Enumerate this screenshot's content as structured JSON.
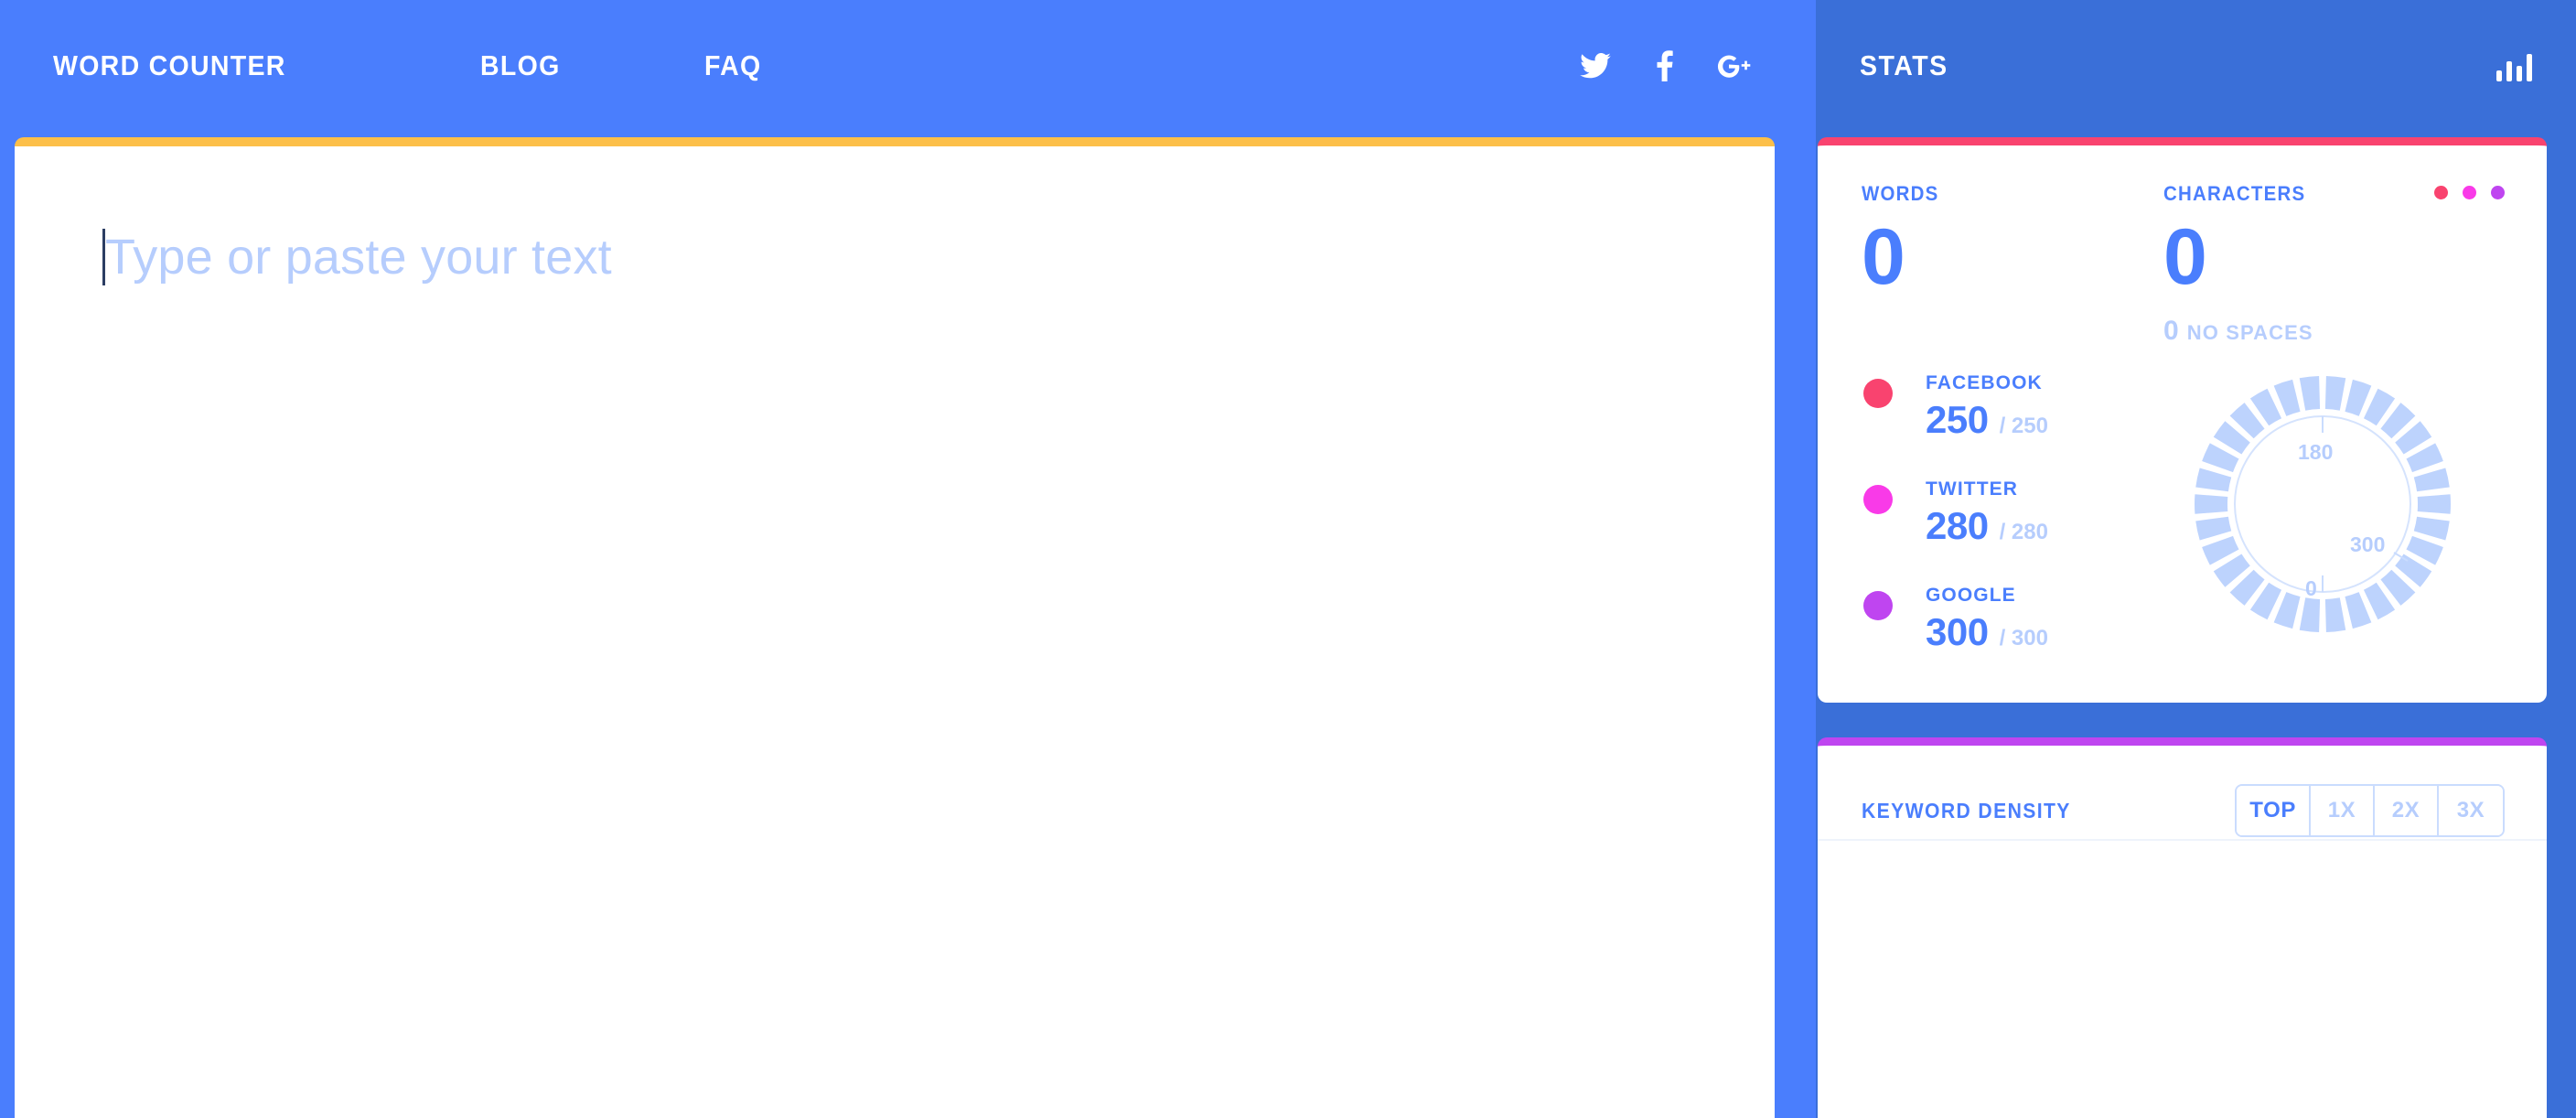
{
  "brand": {
    "accent_blue": "#4a7efd",
    "panel_blue": "#3a6fd8",
    "yellow": "#fcbf49",
    "pink": "#f9436f",
    "magenta": "#f93ae8",
    "purple": "#bf45f0"
  },
  "nav": {
    "items": [
      {
        "label": "WORD COUNTER",
        "name": "nav-word-counter"
      },
      {
        "label": "BLOG",
        "name": "nav-blog"
      },
      {
        "label": "FAQ",
        "name": "nav-faq"
      }
    ],
    "social": [
      {
        "icon": "twitter-icon",
        "label": "Twitter"
      },
      {
        "icon": "facebook-icon",
        "label": "Facebook"
      },
      {
        "icon": "google-plus-icon",
        "label": "Google Plus"
      }
    ]
  },
  "editor": {
    "placeholder": "Type or paste your text",
    "value": ""
  },
  "stats": {
    "title": "STATS",
    "icon": "bar-chart-icon",
    "words": {
      "label": "WORDS",
      "value": "0"
    },
    "characters": {
      "label": "CHARACTERS",
      "value": "0",
      "no_spaces_value": "0",
      "no_spaces_label": "NO SPACES"
    },
    "menu_dots": [
      {
        "color": "#f9436f"
      },
      {
        "color": "#f93ae8"
      },
      {
        "color": "#bf45f0"
      }
    ],
    "limits": [
      {
        "name": "FACEBOOK",
        "current": "250",
        "max": "/ 250",
        "color": "#f9436f"
      },
      {
        "name": "TWITTER",
        "current": "280",
        "max": "/ 280",
        "color": "#f93ae8"
      },
      {
        "name": "GOOGLE",
        "current": "300",
        "max": "/ 300",
        "color": "#bf45f0"
      }
    ]
  },
  "chart_data": {
    "type": "gauge",
    "title": "Character limit radial gauge",
    "segments": 30,
    "value": 0,
    "range": [
      0,
      360
    ],
    "tick_labels": [
      {
        "text": "180",
        "angle_deg": 180
      },
      {
        "text": "300",
        "angle_deg": 300
      },
      {
        "text": "0",
        "angle_deg": 0
      }
    ],
    "segment_color": "#bdd3fd",
    "ring_color": "#d5e3fd",
    "label_color": "#b6cdfd"
  },
  "keyword_density": {
    "title": "KEYWORD DENSITY",
    "options": [
      {
        "label": "TOP",
        "active": true
      },
      {
        "label": "1X",
        "active": false
      },
      {
        "label": "2X",
        "active": false
      },
      {
        "label": "3X",
        "active": false
      }
    ],
    "rows": []
  }
}
